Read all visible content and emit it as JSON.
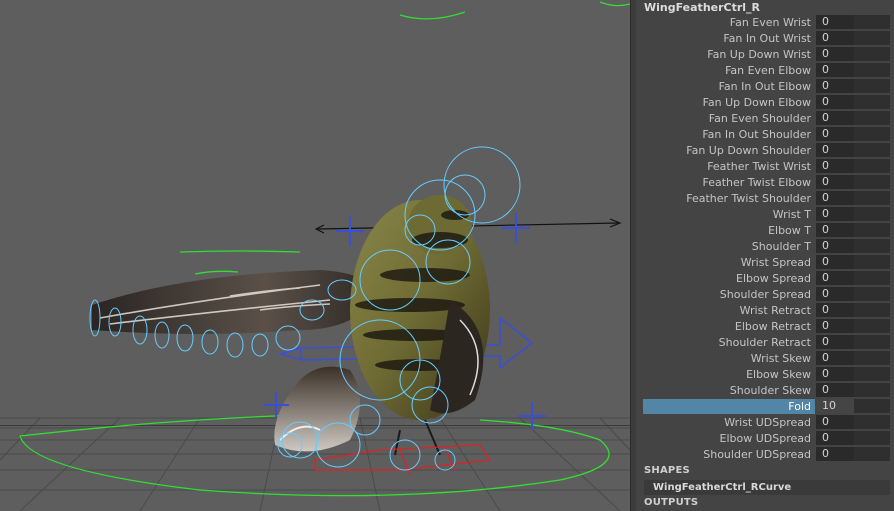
{
  "node_name": "WingFeatherCtrl_R",
  "attributes": [
    {
      "label": "Fan Even Wrist",
      "value": "0"
    },
    {
      "label": "Fan In Out Wrist",
      "value": "0"
    },
    {
      "label": "Fan Up Down Wrist",
      "value": "0"
    },
    {
      "label": "Fan Even Elbow",
      "value": "0"
    },
    {
      "label": "Fan In Out Elbow",
      "value": "0"
    },
    {
      "label": "Fan Up Down Elbow",
      "value": "0"
    },
    {
      "label": "Fan Even Shoulder",
      "value": "0"
    },
    {
      "label": "Fan In Out Shoulder",
      "value": "0"
    },
    {
      "label": "Fan Up Down Shoulder",
      "value": "0"
    },
    {
      "label": "Feather Twist Wrist",
      "value": "0"
    },
    {
      "label": "Feather Twist Elbow",
      "value": "0"
    },
    {
      "label": "Feather Twist Shoulder",
      "value": "0"
    },
    {
      "label": "Wrist T",
      "value": "0"
    },
    {
      "label": "Elbow T",
      "value": "0"
    },
    {
      "label": "Shoulder T",
      "value": "0"
    },
    {
      "label": "Wrist Spread",
      "value": "0"
    },
    {
      "label": "Elbow Spread",
      "value": "0"
    },
    {
      "label": "Shoulder Spread",
      "value": "0"
    },
    {
      "label": "Wrist Retract",
      "value": "0"
    },
    {
      "label": "Elbow Retract",
      "value": "0"
    },
    {
      "label": "Shoulder Retract",
      "value": "0"
    },
    {
      "label": "Wrist Skew",
      "value": "0"
    },
    {
      "label": "Elbow Skew",
      "value": "0"
    },
    {
      "label": "Shoulder Skew",
      "value": "0"
    },
    {
      "label": "Fold",
      "value": "10",
      "selected": true
    },
    {
      "label": "Wrist UDSpread",
      "value": "0"
    },
    {
      "label": "Elbow UDSpread",
      "value": "0"
    },
    {
      "label": "Shoulder UDSpread",
      "value": "0"
    }
  ],
  "sections": {
    "shapes_header": "SHAPES",
    "shape_item": "WingFeatherCtrl_RCurve",
    "outputs_header": "OUTPUTS"
  },
  "colors": {
    "viewport_bg": "#5e5e5e",
    "panel_bg": "#444444",
    "selection": "#5285a6",
    "control_blue": "#3a4fd8",
    "control_cyan": "#66ccff",
    "control_green": "#33dd33",
    "control_red": "#dd2222"
  }
}
